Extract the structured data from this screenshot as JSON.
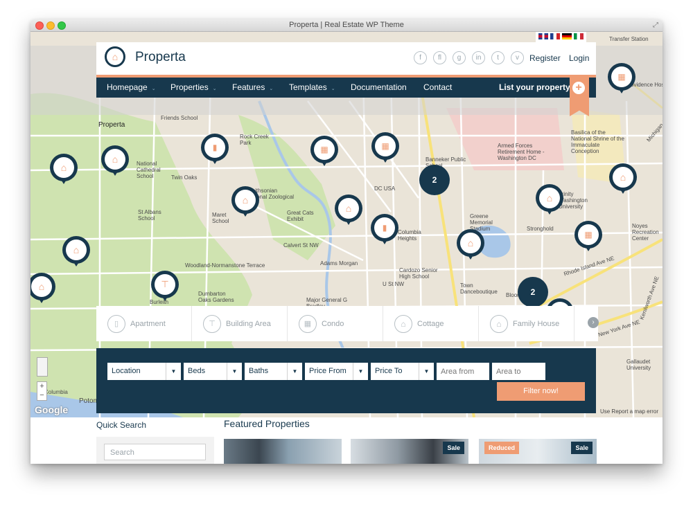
{
  "window": {
    "title": "Properta | Real Estate WP Theme"
  },
  "header": {
    "brand": "Properta",
    "social": [
      "f",
      "fl",
      "g",
      "in",
      "t",
      "v"
    ],
    "register": "Register",
    "login": "Login",
    "flags": [
      "uk-flag",
      "france-flag",
      "germany-flag",
      "italy-flag"
    ]
  },
  "nav": {
    "items": [
      {
        "label": "Homepage",
        "caret": "⌄"
      },
      {
        "label": "Properties",
        "caret": "⌄"
      },
      {
        "label": "Features",
        "caret": "⌄"
      },
      {
        "label": "Templates",
        "caret": "⌄"
      },
      {
        "label": "Documentation",
        "caret": ""
      },
      {
        "label": "Contact",
        "caret": ""
      }
    ],
    "cta": "List your property",
    "cta_icon": "+"
  },
  "map": {
    "labels": [
      "Properta",
      "Friends School",
      "Rock Creek Park",
      "National Cathedral School",
      "Twin Oaks",
      "St Albans School",
      "Maret School",
      "Smithsonian National Zoological Park",
      "Great Cats Exhibit",
      "Calvert St NW",
      "Woodland-Normanstone Terrace",
      "Adams Morgan",
      "Columbia Heights",
      "Cardozo Senior High School",
      "Major General G Bradley McClellan Park",
      "Dumbarton Oaks Gardens",
      "Burleith Hillandale",
      "Armed Forces Retirement Home - Washington DC",
      "Basilica of the National Shrine of the Immaculate Conception",
      "Trinity Washington University",
      "Greene Memorial Stadium",
      "Stronghold",
      "Bloomingdale",
      "Noyes Recreation Center",
      "Gallaudet University",
      "Rhode Island Ave NE",
      "New York Ave NE",
      "Providence Hospital",
      "Transfer Station",
      "DC USA",
      "Town Danceboutique",
      "Banneker Public School",
      "U St NW",
      "Kenilworth Ave NE",
      "Michigan Ave NE",
      "Potomac",
      "Columbia"
    ],
    "clusters": [
      "2",
      "2"
    ],
    "zoom_in": "+",
    "zoom_out": "−",
    "google": "Google",
    "footer": "Use   Report a map error"
  },
  "property_types": [
    "Apartment",
    "Building Area",
    "Condo",
    "Cottage",
    "Family House"
  ],
  "search": {
    "location": "Location",
    "beds": "Beds",
    "baths": "Baths",
    "price_from": "Price From",
    "price_to": "Price To",
    "area_from_placeholder": "Area from",
    "area_to_placeholder": "Area to",
    "submit": "Filter now!"
  },
  "sidebar": {
    "title": "Quick Search",
    "search_placeholder": "Search"
  },
  "featured": {
    "title": "Featured Properties",
    "badges": [
      "Sale",
      "Reduced",
      "Sale"
    ]
  },
  "colors": {
    "navy": "#17384d",
    "accent": "#ef9c73"
  }
}
